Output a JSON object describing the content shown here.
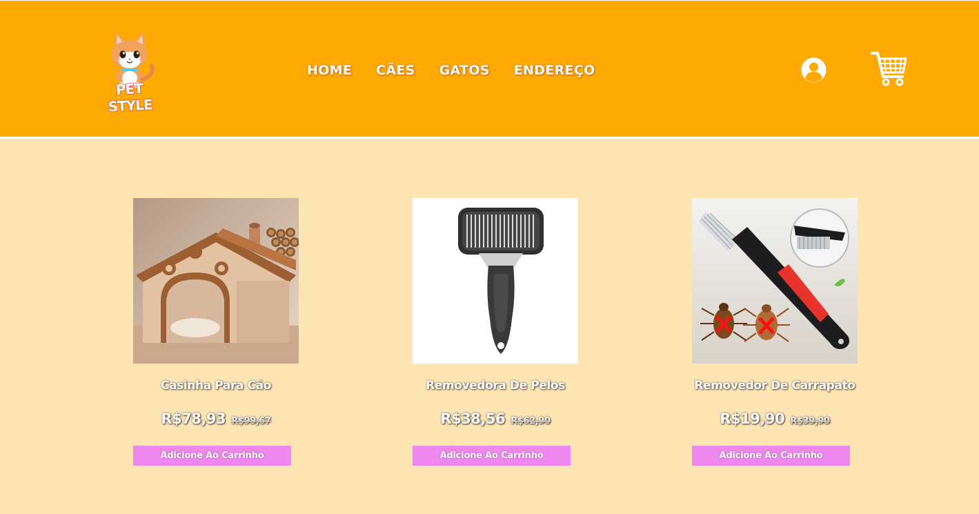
{
  "brand": {
    "logo_text": "PET STYLE",
    "colors": {
      "header_bg": "#ffa904",
      "page_bg": "#fde4b3",
      "button_bg": "#ee88ee"
    }
  },
  "nav": {
    "items": [
      {
        "label": "HOME"
      },
      {
        "label": "CÃES"
      },
      {
        "label": "GATOS"
      },
      {
        "label": "ENDEREÇO"
      }
    ]
  },
  "header_icons": {
    "user": "user-account-icon",
    "cart": "shopping-cart-icon"
  },
  "products": [
    {
      "name": "Casinha Para Cão",
      "price": "R$78,93",
      "old_price": "R$99,67",
      "button": "Adicione Ao Carrinho",
      "image": "dog-house-image"
    },
    {
      "name": "Removedora De Pelos",
      "price": "R$38,56",
      "old_price": "R$62,90",
      "button": "Adicione Ao Carrinho",
      "image": "pet-hair-brush-image"
    },
    {
      "name": "Removedor De Carrapato",
      "price": "R$19,90",
      "old_price": "R$39,90",
      "button": "Adicione Ao Carrinho",
      "image": "tick-remover-comb-image"
    }
  ]
}
